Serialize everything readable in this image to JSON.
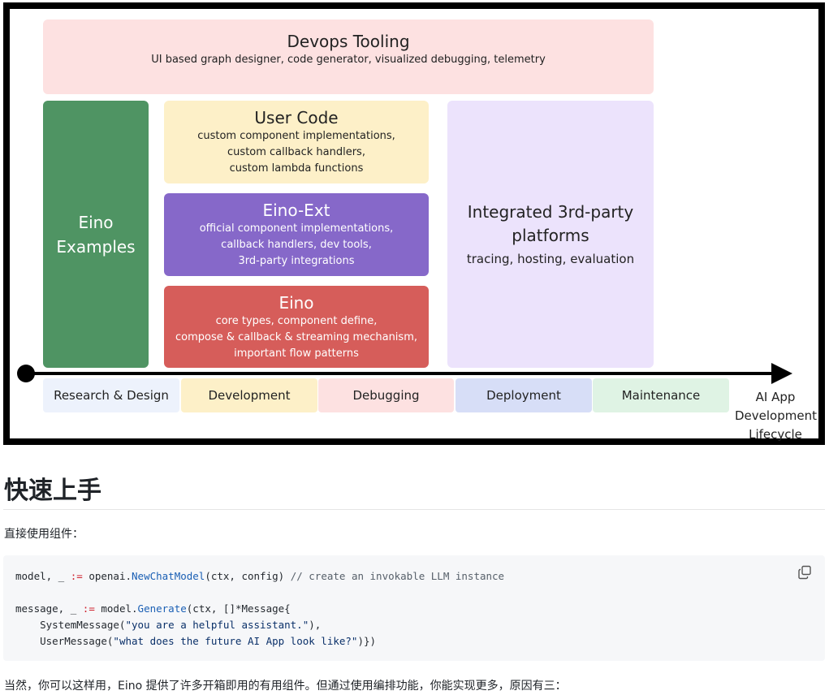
{
  "figure": {
    "devops": {
      "title": "Devops Tooling",
      "subtitle": "UI based graph designer, code generator, visualized debugging, telemetry"
    },
    "examples": {
      "line1": "Eino",
      "line2": "Examples"
    },
    "user_code": {
      "title": "User Code",
      "lines": [
        "custom component implementations,",
        "custom callback handlers,",
        "custom lambda functions"
      ]
    },
    "eino_ext": {
      "title": "Eino-Ext",
      "lines": [
        "official component implementations,",
        "callback handlers, dev tools,",
        "3rd-party integrations"
      ]
    },
    "eino": {
      "title": "Eino",
      "lines": [
        "core types, component define,",
        "compose & callback & streaming mechanism,",
        "important flow patterns"
      ]
    },
    "platforms": {
      "title_line1": "Integrated 3rd-party",
      "title_line2": "platforms",
      "subtitle": "tracing, hosting, evaluation"
    },
    "stages": [
      "Research & Design",
      "Development",
      "Debugging",
      "Deployment",
      "Maintenance"
    ],
    "lifecycle": [
      "AI App",
      "Development",
      "Lifecycle"
    ]
  },
  "heading": "快速上手",
  "intro": "直接使用组件：",
  "code": {
    "line1_a": "model, _ ",
    "line1_op": ":=",
    "line1_b": " openai.",
    "line1_fn": "NewChatModel",
    "line1_c": "(ctx, config) ",
    "line1_cm": "// create an invokable LLM instance",
    "line3_a": "message, _ ",
    "line3_op": ":=",
    "line3_b": " model.",
    "line3_fn": "Generate",
    "line3_c": "(ctx, []*Message{",
    "line4_a": "    SystemMessage(",
    "line4_str": "\"you are a helpful assistant.\"",
    "line4_b": "),",
    "line5_a": "    UserMessage(",
    "line5_str": "\"what does the future AI App look like?\"",
    "line5_b": ")})"
  },
  "outro": "当然，你可以这样用，Eino 提供了许多开箱即用的有用组件。但通过使用编排功能，你能实现更多，原因有三："
}
